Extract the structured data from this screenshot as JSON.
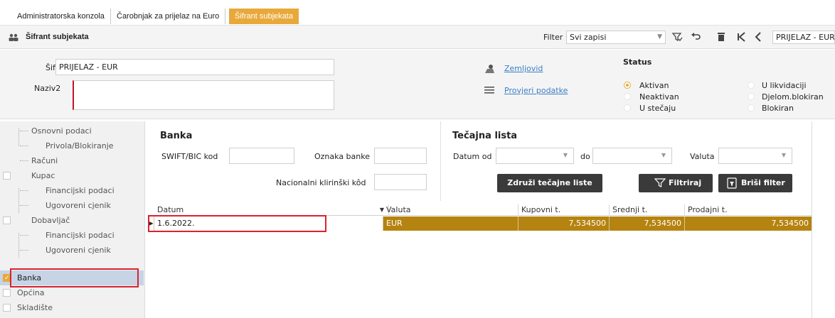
{
  "tabs": [
    {
      "label": "Administratorska konzola",
      "active": false
    },
    {
      "label": "Čarobnjak za prijelaz na Euro",
      "active": false
    },
    {
      "label": "Šifrant subjekata",
      "active": true,
      "close": "✕"
    }
  ],
  "titlebar": {
    "title": "Šifrant subjekata",
    "filter_label": "Filter",
    "filter_value": "Svi zapisi",
    "entity": "PRIJELAZ - EUR"
  },
  "header": {
    "sifra_label": "Šifra",
    "sifra_value": "PRIJELAZ - EUR",
    "naziv2_label": "Naziv2",
    "naziv2_value": "",
    "zemljovid_link": "Zemljovid",
    "provjeri_link": "Provjeri podatke",
    "status_title": "Status",
    "status_options": [
      {
        "label": "Aktivan",
        "selected": true
      },
      {
        "label": "Neaktivan",
        "selected": false
      },
      {
        "label": "U stečaju",
        "selected": false
      },
      {
        "label": "U likvidaciji",
        "selected": false
      },
      {
        "label": "Djelom.blokiran",
        "selected": false
      },
      {
        "label": "Blokiran",
        "selected": false
      }
    ]
  },
  "tree": {
    "items": [
      {
        "label": "Osnovni podaci"
      },
      {
        "label": "Privola/Blokiranje"
      },
      {
        "label": "Računi"
      },
      {
        "label": "Kupac"
      },
      {
        "label": "Financijski podaci"
      },
      {
        "label": "Ugovoreni cjenik"
      },
      {
        "label": "Dobavljač"
      },
      {
        "label": "Financijski podaci"
      },
      {
        "label": "Ugovoreni cjenik"
      },
      {
        "label": "Banka"
      },
      {
        "label": "Općina"
      },
      {
        "label": "Skladište"
      }
    ]
  },
  "banka": {
    "title": "Banka",
    "swift_label": "SWIFT/BIC kod",
    "swift_value": "",
    "oznaka_label": "Oznaka banke",
    "oznaka_value": "",
    "nkk_label": "Nacionalni klirinški kôd",
    "nkk_value": ""
  },
  "tecajna": {
    "title": "Tečajna lista",
    "datum_od_label": "Datum od",
    "do_label": "do",
    "valuta_label": "Valuta",
    "btn_zdruzi": "Združi tečajne liste",
    "btn_filtriraj": "Filtriraj",
    "btn_brisi": "Briši filter"
  },
  "grid": {
    "columns": [
      "Datum",
      "Valuta",
      "Kupovni t.",
      "Srednji t.",
      "Prodajni t."
    ],
    "rows": [
      {
        "datum": "1.6.2022.",
        "valuta": "EUR",
        "kupovni": "7,534500",
        "srednji": "7,534500",
        "prodajni": "7,534500"
      }
    ]
  },
  "colors": {
    "accent": "#e8a93a",
    "row_selected": "#b5830f",
    "annotation": "#d9232e"
  }
}
